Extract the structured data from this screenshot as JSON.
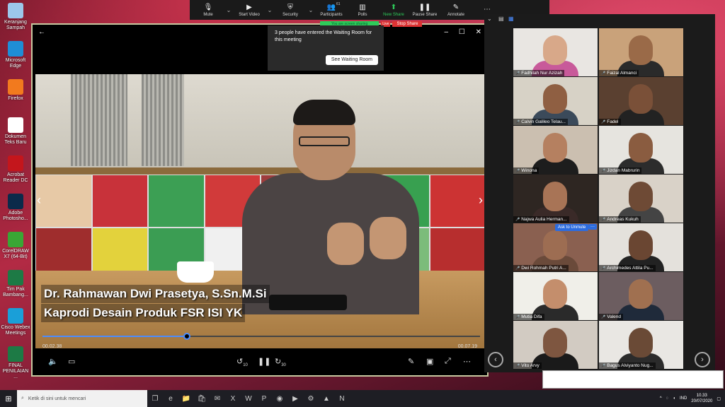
{
  "desktop_icons": [
    {
      "label": "Keranjang Sampah",
      "icon": "recycle-bin-icon",
      "color": "#9cc7ea"
    },
    {
      "label": "Microsoft Edge",
      "icon": "edge-icon",
      "color": "#1f8ed6"
    },
    {
      "label": "Firefox",
      "icon": "firefox-icon",
      "color": "#f27a1e"
    },
    {
      "label": "Dokumen Teks Baru",
      "icon": "text-document-icon",
      "color": "#ffffff"
    },
    {
      "label": "Acrobat Reader DC",
      "icon": "acrobat-icon",
      "color": "#c4161c"
    },
    {
      "label": "Adobe Photosho...",
      "icon": "photoshop-icon",
      "color": "#0b2a4a"
    },
    {
      "label": "CorelDRAW X7 (64-Bit)",
      "icon": "coreldraw-icon",
      "color": "#3aa635"
    },
    {
      "label": "Tim Pak Bambang...",
      "icon": "excel-file-icon",
      "color": "#1d7a45"
    },
    {
      "label": "Cisco Webex Meetings",
      "icon": "webex-icon",
      "color": "#1a9fd8"
    },
    {
      "label": "FINAL PENILAIAN ...",
      "icon": "excel-file-icon",
      "color": "#1d7a45"
    }
  ],
  "zoom_toolbar": {
    "items": [
      {
        "label": "Mute",
        "icon": "microphone-icon"
      },
      {
        "label": "Start Video",
        "icon": "video-camera-icon"
      },
      {
        "label": "Security",
        "icon": "shield-icon"
      },
      {
        "label": "Participants",
        "icon": "participants-icon",
        "count": "61"
      },
      {
        "label": "Polls",
        "icon": "polls-icon"
      },
      {
        "label": "New Share",
        "icon": "share-screen-icon"
      },
      {
        "label": "Pause Share",
        "icon": "pause-icon"
      },
      {
        "label": "Annotate",
        "icon": "annotate-icon"
      }
    ],
    "share_status": "You are screen sharing",
    "live_label": "Live",
    "stop_share_label": "Stop Share"
  },
  "waiting_room": {
    "message": "3 people have entered the Waiting Room for this meeting",
    "button": "See Waiting Room"
  },
  "video": {
    "caption_name": "Dr. Rahmawan Dwi Prasetya, S.Sn.M.Si",
    "caption_title": "Kaprodi Desain Produk FSR ISI YK",
    "current_time": "00.02.38",
    "duration": "00.07.19",
    "progress": 0.33,
    "skip_back": "10",
    "skip_forward": "30"
  },
  "gallery": {
    "participants": [
      {
        "name": "Fadhilah Nur Azizah",
        "bg": "#e9e6e2",
        "skin": "#d8a889",
        "cloth": "#c85a9a"
      },
      {
        "name": "Faizal Almanci",
        "bg": "#c9a27a",
        "skin": "#9a6a48",
        "cloth": "#2a2a2a"
      },
      {
        "name": "Calvin Galileo Telau...",
        "bg": "#d7d2c6",
        "skin": "#8f5f42",
        "cloth": "#3b4a5a"
      },
      {
        "name": "Fadel",
        "bg": "#5a4030",
        "skin": "#7a5038",
        "cloth": "#222222"
      },
      {
        "name": "Winona",
        "bg": "#cbbfb0",
        "skin": "#b58060",
        "cloth": "#1d1d1d"
      },
      {
        "name": "Jizdan Mabrurin",
        "bg": "#e6e4df",
        "skin": "#8a5c40",
        "cloth": "#2c2c2c"
      },
      {
        "name": "Najwa Aulia Herman...",
        "bg": "#2e2622",
        "skin": "#a87456",
        "cloth": "#3a2a28"
      },
      {
        "name": "Andreas Kukuh",
        "bg": "#d9d2c8",
        "skin": "#6e4a35",
        "cloth": "#444444"
      },
      {
        "name": "Dwi Rohmah Putri A...",
        "bg": "#8a6050",
        "skin": "#9d6d52",
        "cloth": "#6a4a3a"
      },
      {
        "name": "Archimedes Attila Pu...",
        "bg": "#e4e1dc",
        "skin": "#6a4632",
        "cloth": "#222222"
      },
      {
        "name": "Mutia Difa",
        "bg": "#f0efe9",
        "skin": "#c48e6c",
        "cloth": "#2a2a2a"
      },
      {
        "name": "Valend",
        "bg": "#6c5d60",
        "skin": "#a07050",
        "cloth": "#1f2a3a"
      },
      {
        "name": "Vito Arvy",
        "bg": "#d2cbc2",
        "skin": "#7e5640",
        "cloth": "#1a1a1a"
      },
      {
        "name": "Bagus Alviyanto Nug...",
        "bg": "#e9e7e3",
        "skin": "#6a4a36",
        "cloth": "#2b2b2b"
      }
    ],
    "ask_to_unmute": "Ask to Unmute",
    "more_label": "···"
  },
  "taskbar": {
    "search_placeholder": "Ketik di sini untuk mencari",
    "apps": [
      "task-view-icon",
      "edge-icon",
      "explorer-icon",
      "store-icon",
      "mail-icon",
      "excel-icon",
      "word-icon",
      "powerpoint-icon",
      "chrome-icon",
      "zoom-icon",
      "settings-icon",
      "photos-icon",
      "onenote-icon"
    ],
    "language": "IND",
    "time": "10.33",
    "date": "20/07/2020"
  }
}
